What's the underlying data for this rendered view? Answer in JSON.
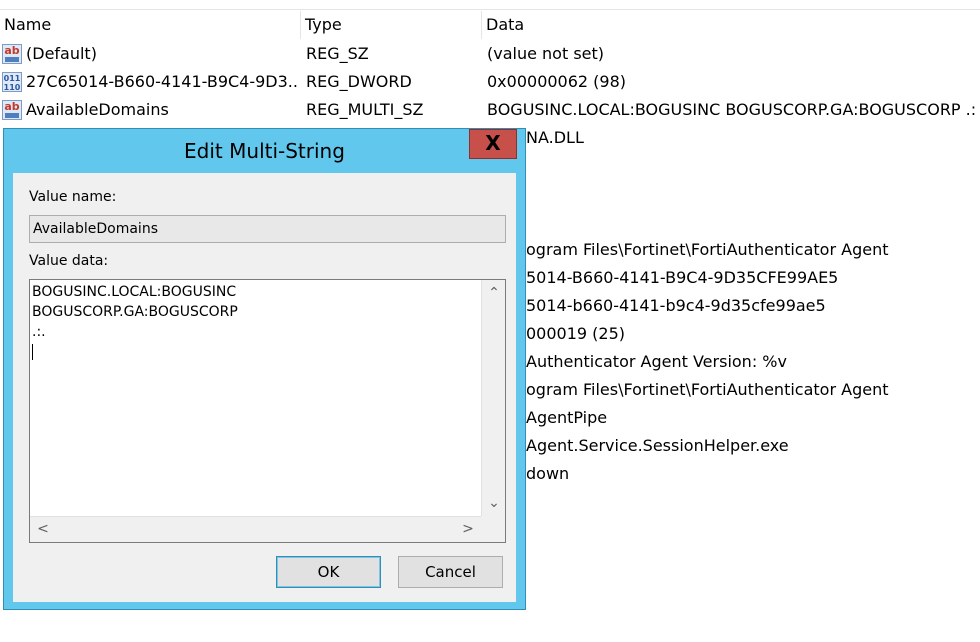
{
  "columns": {
    "name": "Name",
    "type": "Type",
    "data": "Data"
  },
  "rows": [
    {
      "icon": "string-value-icon",
      "name": "(Default)",
      "type": "REG_SZ",
      "data": "(value not set)"
    },
    {
      "icon": "dword-value-icon",
      "name": "27C65014-B660-4141-B9C4-9D3...",
      "type": "REG_DWORD",
      "data": "0x00000062 (98)"
    },
    {
      "icon": "string-value-icon",
      "name": "AvailableDomains",
      "type": "REG_MULTI_SZ",
      "data": "BOGUSINC.LOCAL:BOGUSINC BOGUSCORP.GA:BOGUSCORP .:."
    }
  ],
  "hidden_row_fragments": [
    "NA.DLL",
    "ogram Files\\Fortinet\\FortiAuthenticator Agent",
    "5014-B660-4141-B9C4-9D35CFE99AE5",
    "5014-b660-4141-b9c4-9d35cfe99ae5",
    "000019 (25)",
    "Authenticator Agent Version: %v",
    "ogram Files\\Fortinet\\FortiAuthenticator Agent",
    "AgentPipe",
    "Agent.Service.SessionHelper.exe",
    "down"
  ],
  "dialog": {
    "title": "Edit Multi-String",
    "close_glyph": "X",
    "value_name_label": "Value name:",
    "value_name": "AvailableDomains",
    "value_data_label": "Value data:",
    "value_data": "BOGUSINC.LOCAL:BOGUSINC\nBOGUSCORP.GA:BOGUSCORP\n.:.",
    "ok_label": "OK",
    "cancel_label": "Cancel",
    "scroll_up": "⌃",
    "scroll_down": "⌄",
    "scroll_left": "<",
    "scroll_right": ">"
  },
  "colors": {
    "dialog_frame": "#62c7ec",
    "close_button": "#c7504a"
  }
}
